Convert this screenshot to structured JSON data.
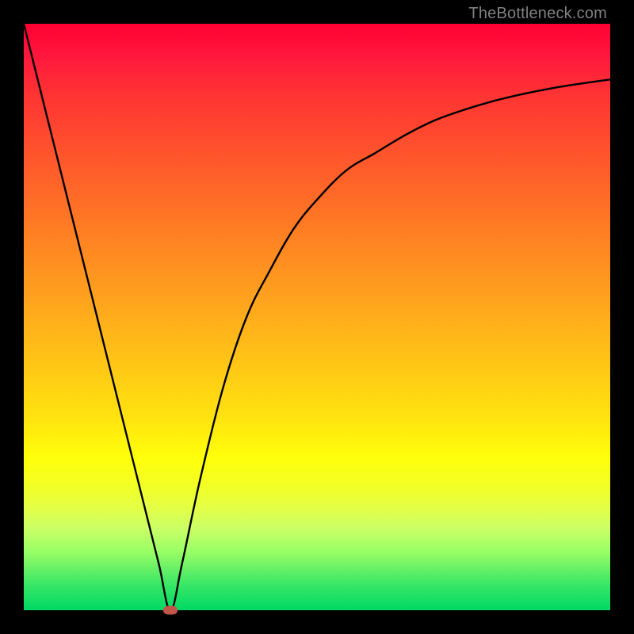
{
  "watermark": "TheBottleneck.com",
  "colors": {
    "frame": "#000000",
    "curve_stroke": "#000000",
    "marker": "#c2554a",
    "watermark_text": "#808080"
  },
  "chart_data": {
    "type": "line",
    "title": "",
    "xlabel": "",
    "ylabel": "",
    "xlim": [
      0,
      100
    ],
    "ylim": [
      0,
      100
    ],
    "annotations": [
      "TheBottleneck.com"
    ],
    "legend": false,
    "grid": false,
    "background": "gradient-heatmap",
    "gradient_stops": [
      {
        "pos": 0.0,
        "color": "#ff0033"
      },
      {
        "pos": 0.2,
        "color": "#ff4d2e"
      },
      {
        "pos": 0.44,
        "color": "#ff991f"
      },
      {
        "pos": 0.68,
        "color": "#ffe60f"
      },
      {
        "pos": 0.82,
        "color": "#e6ff40"
      },
      {
        "pos": 1.0,
        "color": "#00d966"
      }
    ],
    "series": [
      {
        "name": "bottleneck-curve",
        "x": [
          0,
          4,
          8,
          12,
          16,
          20,
          23,
          25,
          27,
          30,
          34,
          38,
          42,
          46,
          50,
          55,
          60,
          65,
          70,
          75,
          80,
          85,
          90,
          95,
          100
        ],
        "values": [
          100,
          84,
          68,
          52,
          36,
          20,
          8,
          0,
          8,
          22,
          38,
          50,
          58,
          65,
          70,
          75,
          78,
          81,
          83.5,
          85.3,
          86.8,
          88,
          89,
          89.8,
          90.5
        ]
      }
    ],
    "markers": [
      {
        "name": "minimum",
        "x": 25,
        "y": 0
      }
    ]
  }
}
